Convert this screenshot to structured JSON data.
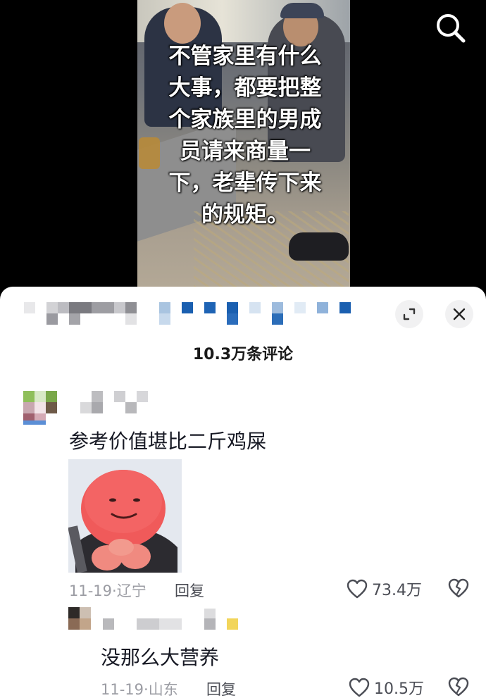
{
  "video": {
    "caption": "不管家里有什么\n大事，都要把整\n个家族里的男成\n员请来商量一\n下，老辈传下来\n的规矩。"
  },
  "header": {
    "comment_count": "10.3万条评论"
  },
  "comments": [
    {
      "text": "参考价值堪比二斤鸡屎",
      "date_location": "11-19·辽宁",
      "reply_label": "回复",
      "likes": "73.4万",
      "has_sticker": true
    },
    {
      "text": "没那么大营养",
      "date_location": "11-19·山东",
      "reply_label": "回复",
      "likes": "10.5万"
    }
  ],
  "colors": {
    "sheet_bg": "#ffffff",
    "accent_blue": "#1a5fb0",
    "text_primary": "#161823",
    "text_meta": "#9b9ca3"
  },
  "icons": [
    "search-icon",
    "collapse-icon",
    "close-icon",
    "heart-icon",
    "broken-heart-icon"
  ]
}
